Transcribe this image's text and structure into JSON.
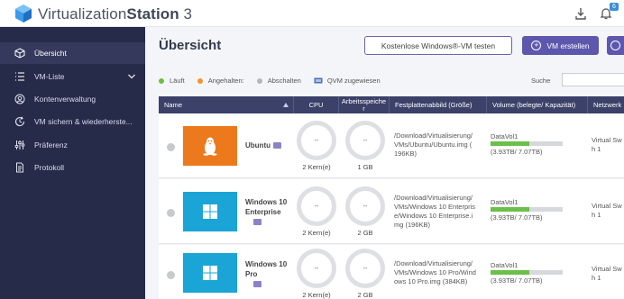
{
  "app": {
    "title_main": "Virtualization",
    "title_bold": "Station",
    "title_suffix": " 3",
    "notification_count": "6"
  },
  "sidebar": {
    "items": [
      {
        "label": "Übersicht",
        "icon": "overview-icon"
      },
      {
        "label": "VM-Liste",
        "icon": "list-icon"
      },
      {
        "label": "Kontenverwaltung",
        "icon": "account-icon"
      },
      {
        "label": "VM sichern & wiederherste...",
        "icon": "backup-icon"
      },
      {
        "label": "Präferenz",
        "icon": "preferences-icon"
      },
      {
        "label": "Protokoll",
        "icon": "log-icon"
      }
    ]
  },
  "main": {
    "title": "Übersicht",
    "btn_trial": "Kostenlose Windows®-VM testen",
    "btn_create": "VM erstellen",
    "btn_create_icon": "+"
  },
  "legend": {
    "running": "Läuft",
    "paused": "Angehalten:",
    "off": "Abschalten",
    "qvm": "QVM zugewiesen",
    "colors": {
      "running": "#6abf3f",
      "paused": "#f0962a",
      "off": "#b4b6bb"
    }
  },
  "search": {
    "label": "Suche",
    "placeholder": ""
  },
  "table": {
    "headers": {
      "name": "Name",
      "cpu": "CPU",
      "memory": "Arbeitsspeiche r",
      "disk": "Festplattenabbild (Größe)",
      "volume": "Volume (belegte/ Kapazität)",
      "network": "Netzwerk"
    },
    "rows": [
      {
        "name_line1": "Ubuntu",
        "name_line2": "",
        "os": "ubuntu",
        "cpu_value": "--",
        "cpu_caption": "2 Kern(e)",
        "mem_value": "--",
        "mem_caption": "1 GB",
        "path_line1": "/Download/Virtualisierung/",
        "path_line2": "VMs/Ubuntu/Ubuntu.img (",
        "path_line3": "196KB)",
        "volume_name": "DataVol1",
        "volume_used_fraction": 0.54,
        "volume_capacity": "(3.93TB/ 7.07TB)",
        "network_line1": "Virtual Sw",
        "network_line2": "h 1"
      },
      {
        "name_line1": "Windows 10",
        "name_line2": "Enterprise",
        "os": "windows",
        "cpu_value": "--",
        "cpu_caption": "2 Kern(e)",
        "mem_value": "--",
        "mem_caption": "2 GB",
        "path_line1": "/Download/Virtualisierung/",
        "path_line2": "VMs/Windows 10 Enterpris",
        "path_line3": "e/Windows 10 Enterprise.i",
        "path_line4": "mg (196KB)",
        "volume_name": "DataVol1",
        "volume_used_fraction": 0.54,
        "volume_capacity": "(3.93TB/ 7.07TB)",
        "network_line1": "Virtual Sw",
        "network_line2": "h 1"
      },
      {
        "name_line1": "Windows 10",
        "name_line2": "Pro",
        "os": "windows",
        "cpu_value": "--",
        "cpu_caption": "2 Kern(e)",
        "mem_value": "--",
        "mem_caption": "2 GB",
        "path_line1": "/Download/Virtualisierung/",
        "path_line2": "VMs/Windows 10 Pro/Wind",
        "path_line3": "ows 10 Pro.img (384KB)",
        "volume_name": "DataVol1",
        "volume_used_fraction": 0.54,
        "volume_capacity": "(3.93TB/ 7.07TB)",
        "network_line1": "Virtual Sw",
        "network_line2": "h 1"
      }
    ]
  }
}
